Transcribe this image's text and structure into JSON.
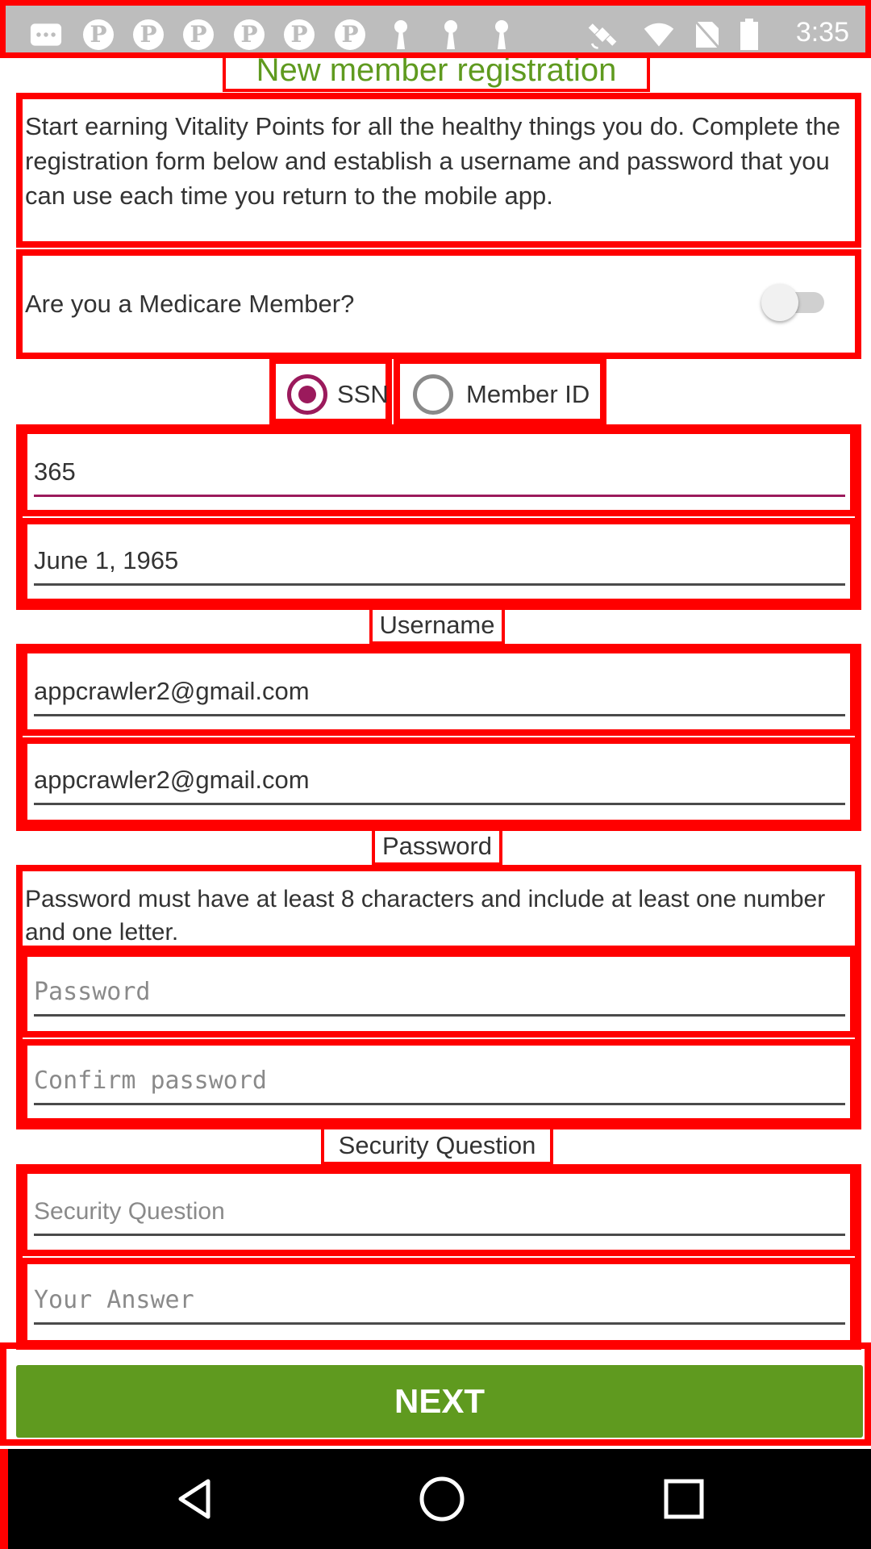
{
  "status_bar": {
    "time": "3:35",
    "icons": [
      "message-icon",
      "pinterest-icon",
      "pinterest-icon",
      "pinterest-icon",
      "pinterest-icon",
      "pinterest-icon",
      "pinterest-icon",
      "keyhole-icon",
      "keyhole-icon",
      "keyhole-icon",
      "fake-gps-icon",
      "wifi-icon",
      "no-sim-icon",
      "battery-icon"
    ]
  },
  "page": {
    "title": "New member registration",
    "intro": "Start earning Vitality Points for all the healthy things you do. Complete the registration form below and establish a username and password that you can use each time you return to the mobile app."
  },
  "medicare": {
    "question": "Are you a Medicare Member?",
    "toggle_on": false
  },
  "id_type": {
    "options": [
      "SSN",
      "Member ID"
    ],
    "selected": "SSN"
  },
  "fields": {
    "ssn_value": "365",
    "dob_value": "June 1, 1965"
  },
  "username": {
    "label": "Username",
    "value": "appcrawler2@gmail.com",
    "confirm_value": "appcrawler2@gmail.com"
  },
  "password": {
    "label": "Password",
    "hint": "Password must have at least 8 characters and include at least one number and one letter.",
    "placeholder": "Password",
    "confirm_placeholder": "Confirm password"
  },
  "security": {
    "label": "Security Question",
    "question_placeholder": "Security Question",
    "answer_placeholder": "Your Answer"
  },
  "actions": {
    "next_label": "NEXT"
  },
  "colors": {
    "accent": "#9b1a5c",
    "brand_green": "#5f9a1f",
    "annotation_red": "#ff0000"
  },
  "nav_bar": {
    "icons": [
      "back-icon",
      "home-icon",
      "recents-icon"
    ]
  }
}
